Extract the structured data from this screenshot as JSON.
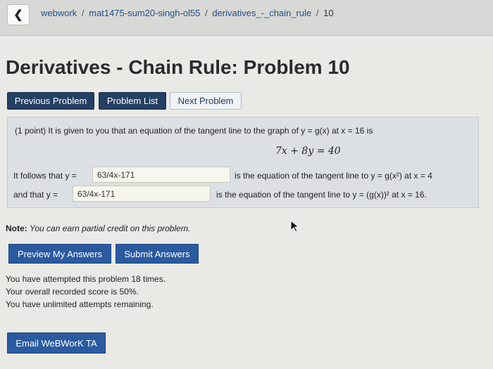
{
  "breadcrumb": {
    "items": [
      "webwork",
      "mat1475-sum20-singh-ol55",
      "derivatives_-_chain_rule",
      "10"
    ],
    "separator": "/"
  },
  "title": "Derivatives - Chain Rule: Problem 10",
  "nav": {
    "previous": "Previous Problem",
    "list": "Problem List",
    "next": "Next Problem"
  },
  "problem": {
    "statement": "(1 point) It is given to you that an equation of the tangent line to the graph of y = g(x) at x = 16 is",
    "equation": "7x + 8y = 40",
    "row1": {
      "prefix": "It follows that y =",
      "value": "63/4x-171",
      "suffix": "is the equation of the tangent line to y = g(x²) at x = 4"
    },
    "row2": {
      "prefix": "and that y =",
      "value": "63/4x-171",
      "suffix": "is the equation of the tangent line to y = (g(x))² at x = 16."
    }
  },
  "note": {
    "label": "Note:",
    "text": "You can earn partial credit on this problem."
  },
  "actions": {
    "preview": "Preview My Answers",
    "submit": "Submit Answers"
  },
  "status": {
    "attempts": "You have attempted this problem 18 times.",
    "score": "Your overall recorded score is 50%.",
    "remaining": "You have unlimited attempts remaining."
  },
  "email": "Email WeBWorK TA",
  "icons": {
    "back": "chevron-left-icon",
    "cursor": "mouse-pointer-icon"
  },
  "colors": {
    "nav_dark": "#233f62",
    "button_blue": "#2a5aa0",
    "problem_bg": "#dcdfe3",
    "input_bg": "#f6f6ec"
  }
}
